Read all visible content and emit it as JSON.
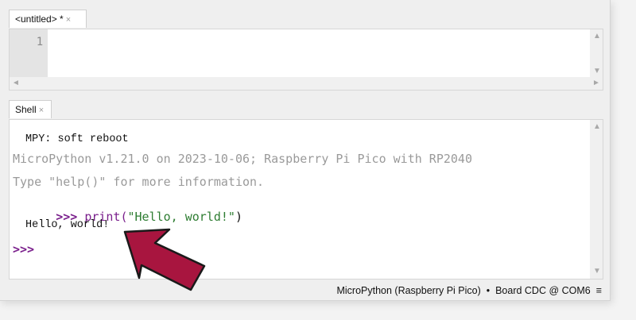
{
  "editor": {
    "tab_label": "<untitled> *",
    "tab_close": "×",
    "line_numbers": [
      "1"
    ]
  },
  "shell": {
    "tab_label": "Shell",
    "tab_close": "×",
    "lines": {
      "soft_reboot": "MPY: soft reboot",
      "banner": "MicroPython v1.21.0 on 2023-10-06; Raspberry Pi Pico with RP2040",
      "help": "Type \"help()\" for more information.",
      "prompt1": ">>>",
      "cmd_func": "print(",
      "cmd_string": "\"Hello, world!\"",
      "cmd_close": ")",
      "output": "Hello, world!",
      "prompt2": ">>>"
    }
  },
  "status_bar": {
    "interpreter": "MicroPython (Raspberry Pi Pico)",
    "separator": "•",
    "port": "Board CDC @ COM6",
    "menu_glyph": "≡"
  },
  "colors": {
    "prompt": "#7a1f8c",
    "string": "#2e7d32",
    "banner_gray": "#9a9a9a",
    "arrow": "#a8153f"
  },
  "icons": {
    "scroll_up": "▲",
    "scroll_down": "▼",
    "scroll_left": "◄",
    "scroll_right": "►"
  }
}
